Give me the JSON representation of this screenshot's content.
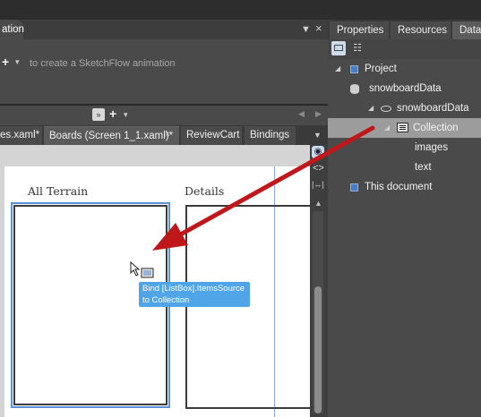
{
  "animation_panel": {
    "tab_fragment": "ation",
    "hint": "to create a SketchFlow animation",
    "add_plus": "+",
    "caret": "▾",
    "pin_glyph": "▼",
    "close_glyph": "×"
  },
  "document_strip": {
    "chevron": "»",
    "plus": "+",
    "caret": "▾",
    "left": "◀",
    "right": "▶"
  },
  "doc_tabs": [
    {
      "label": "es.xaml*"
    },
    {
      "label": "Boards (Screen 1_1.xaml)*"
    },
    {
      "label": "ReviewCart"
    },
    {
      "label": "Bindings"
    }
  ],
  "doc_tab_close": "×",
  "doc_tabs_caret": "▼",
  "artboard": {
    "label_left": "All Terrain",
    "label_right": "Details",
    "tooltip_line1": "Bind [ListBox].ItemsSource",
    "tooltip_line2": "to Collection"
  },
  "toolstrip": {
    "code_glyph": "<>",
    "split_glyph": "|↔|",
    "up_glyph": "▲"
  },
  "right_panel": {
    "tabs": [
      "Properties",
      "Resources",
      "Data"
    ],
    "detail_mode_glyph": "☷",
    "tree": [
      {
        "label": "Project"
      },
      {
        "label": "snowboardData"
      },
      {
        "label": "snowboardData"
      },
      {
        "label": "Collection",
        "selected": true
      },
      {
        "label": "images"
      },
      {
        "label": "text"
      },
      {
        "label": "This document"
      }
    ],
    "caret_expanded": "◢"
  },
  "colors": {
    "accent_selection": "#5b8fd6",
    "tooltip_bg": "#4fa5e8",
    "arrow": "#c0181a",
    "selected_row": "#9c9c9c"
  }
}
